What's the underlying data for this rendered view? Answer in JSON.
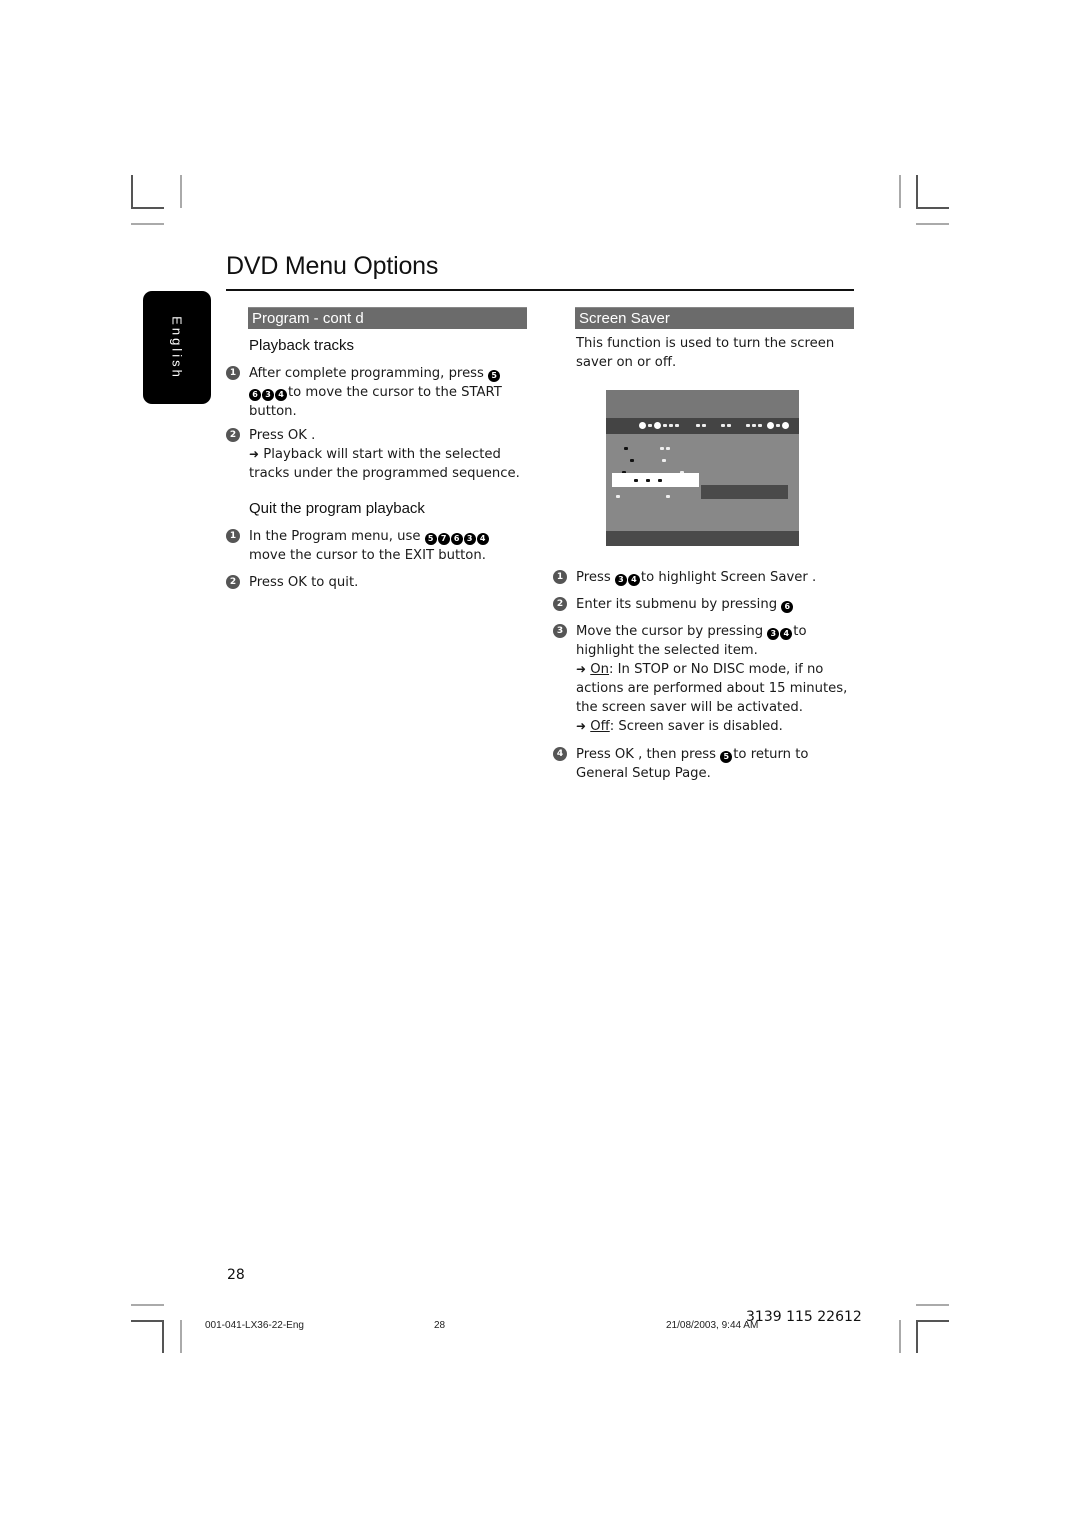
{
  "page": {
    "title": "DVD Menu Options",
    "language_tab": "English",
    "page_number": "28"
  },
  "left_column": {
    "section_header": "Program - cont   d",
    "playback": {
      "heading": "Playback tracks",
      "steps": [
        {
          "number": "1",
          "parts": [
            "After complete programming, press",
            "5",
            "",
            "6",
            "3",
            "4",
            "to move the cursor to the START button."
          ]
        },
        {
          "number": "2",
          "text": "Press OK .",
          "result": "Playback will start with the selected tracks under the programmed sequence."
        }
      ],
      "step1_line1": "After complete programming, press",
      "step1_line2": "to move the cursor to the START",
      "step1_line3": "button.",
      "step1_buttons_a": [
        "5"
      ],
      "step1_buttons_b": [
        "6",
        "3",
        "4"
      ],
      "step2_text": "Press OK .",
      "step2_result_line1": "Playback will start with the selected",
      "step2_result_line2": "tracks under the programmed sequence."
    },
    "quit": {
      "heading": "Quit the program playback",
      "step1_line1": "In the  Program  menu, use",
      "step1_buttons": [
        "5",
        "7",
        "6",
        "3",
        "4"
      ],
      "step1_line2": "move the cursor to the EXIT button.",
      "step2_text": "Press OK  to quit."
    }
  },
  "right_column": {
    "section_header": "Screen Saver",
    "intro_line1": "This function is used to turn the screen",
    "intro_line2": "saver on or off.",
    "steps": {
      "s1_pre": "Press",
      "s1_buttons": [
        "3",
        "4"
      ],
      "s1_post": "to highlight  Screen Saver .",
      "s2_pre": "Enter its submenu by pressing",
      "s2_buttons": [
        "6"
      ],
      "s3_pre": "Move the cursor by pressing",
      "s3_buttons": [
        "3",
        "4"
      ],
      "s3_post": "to",
      "s3_line2": "highlight the selected item.",
      "on_label": "On",
      "on_text": ": In STOP or No DISC mode, if no",
      "on_line2": "actions are performed about 15 minutes,",
      "on_line3": "the screen saver will be activated.",
      "off_label": "Off",
      "off_text": ": Screen saver is disabled.",
      "s4_pre": "Press OK , then press",
      "s4_buttons": [
        "5"
      ],
      "s4_post": "to return to",
      "s4_line2": "General Setup Page."
    }
  },
  "footer": {
    "file_name": "001-041-LX36-22-Eng",
    "sheet_number": "28",
    "timestamp": "21/08/2003, 9:44 AM",
    "part_code": "3139 115 22612"
  },
  "colors": {
    "section_header_bg": "#6b6b6b",
    "language_tab_bg": "#000000"
  }
}
